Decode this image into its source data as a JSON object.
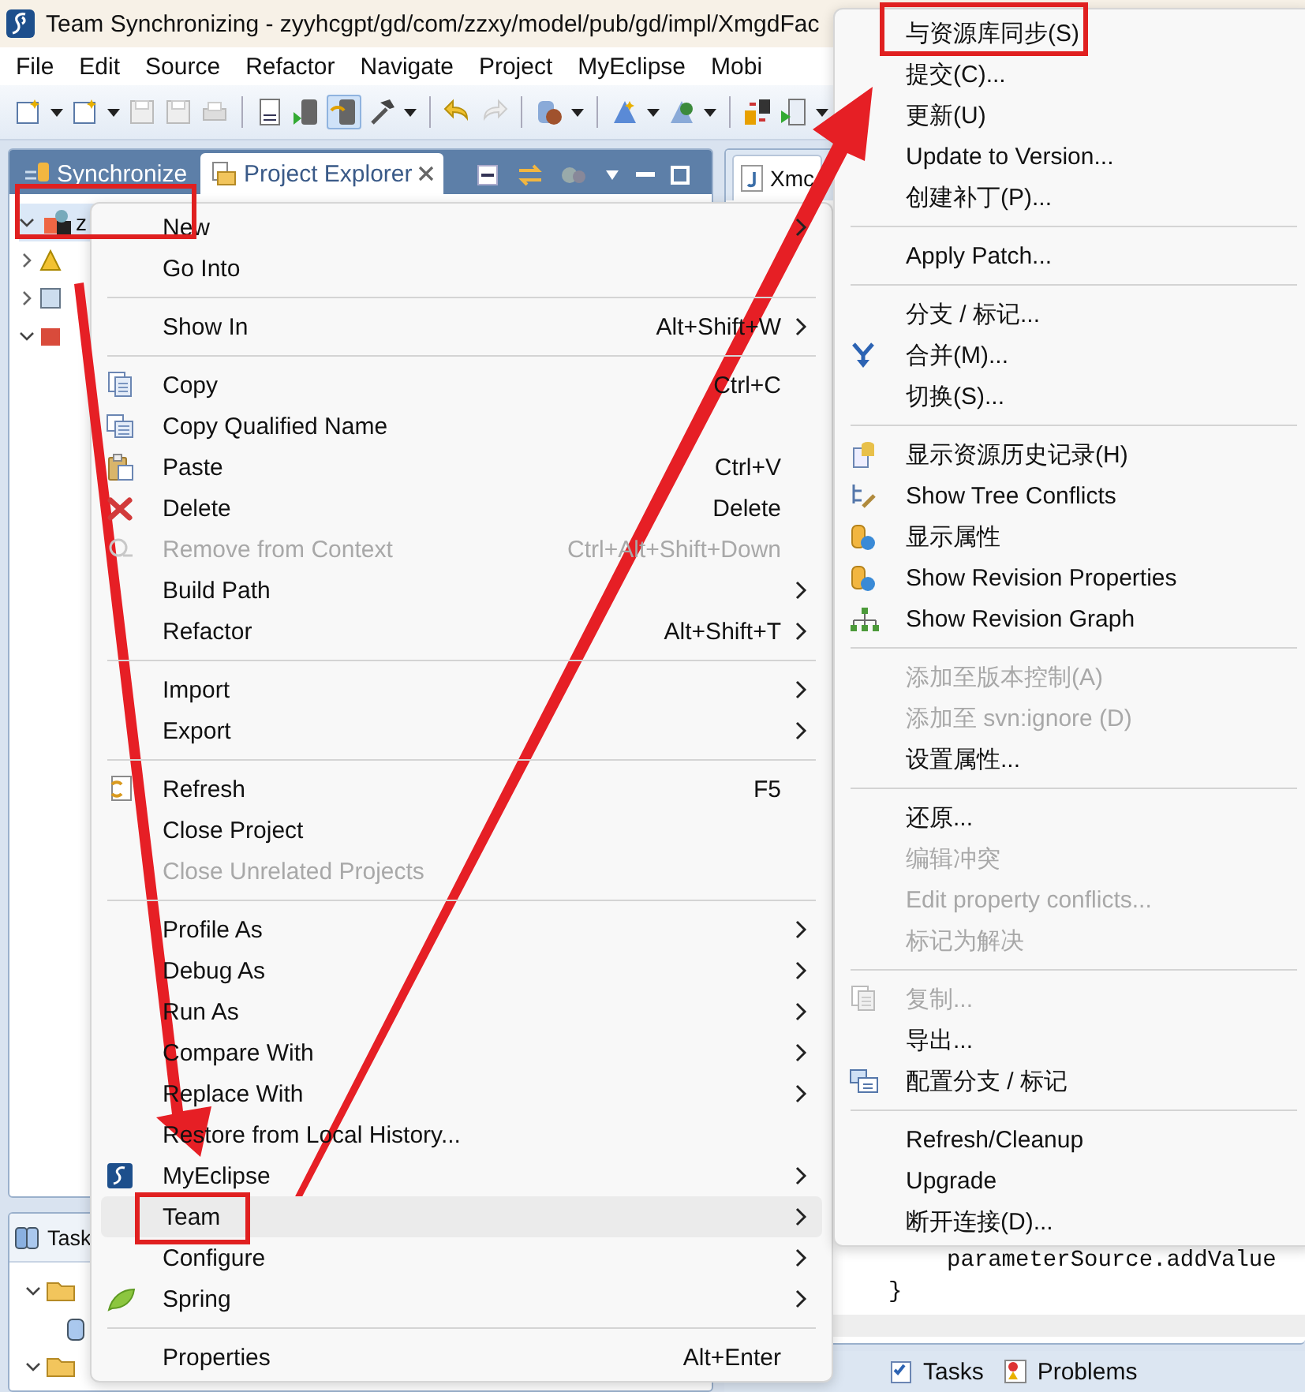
{
  "window": {
    "title": "Team Synchronizing - zyyhcgpt/gd/com/zzxy/model/pub/gd/impl/XmgdFac"
  },
  "menu_bar": [
    "File",
    "Edit",
    "Source",
    "Refactor",
    "Navigate",
    "Project",
    "MyEclipse",
    "Mobi"
  ],
  "explorer": {
    "tabs": [
      {
        "label": "Synchronize",
        "selected": false
      },
      {
        "label": "Project Explorer",
        "selected": true
      }
    ],
    "tree_root": "z"
  },
  "task_panel": {
    "tab": "Task"
  },
  "editor": {
    "tab": "Xmc",
    "code": [
      "parameterSource.addValue",
      "}"
    ],
    "bottom_tabs": [
      "Tasks",
      "Problems"
    ]
  },
  "context_menu": {
    "items": [
      {
        "kind": "item",
        "label": "New",
        "submenu": true,
        "disabled": false,
        "selected": false
      },
      {
        "kind": "item",
        "label": "Go Into",
        "submenu": false,
        "disabled": false,
        "selected": false
      },
      {
        "kind": "separator"
      },
      {
        "kind": "item",
        "label": "Show In",
        "shortcut": "Alt+Shift+W",
        "submenu": true,
        "disabled": false,
        "selected": false
      },
      {
        "kind": "separator"
      },
      {
        "kind": "item",
        "label": "Copy",
        "shortcut": "Ctrl+C",
        "submenu": false,
        "disabled": false,
        "selected": false
      },
      {
        "kind": "item",
        "label": "Copy Qualified Name",
        "submenu": false,
        "disabled": false,
        "selected": false
      },
      {
        "kind": "item",
        "label": "Paste",
        "shortcut": "Ctrl+V",
        "submenu": false,
        "disabled": false,
        "selected": false
      },
      {
        "kind": "item",
        "label": "Delete",
        "shortcut": "Delete",
        "submenu": false,
        "disabled": false,
        "selected": false
      },
      {
        "kind": "item",
        "label": "Remove from Context",
        "shortcut": "Ctrl+Alt+Shift+Down",
        "submenu": false,
        "disabled": true,
        "selected": false
      },
      {
        "kind": "item",
        "label": "Build Path",
        "submenu": true,
        "disabled": false,
        "selected": false
      },
      {
        "kind": "item",
        "label": "Refactor",
        "shortcut": "Alt+Shift+T",
        "submenu": true,
        "disabled": false,
        "selected": false
      },
      {
        "kind": "separator"
      },
      {
        "kind": "item",
        "label": "Import",
        "submenu": true,
        "disabled": false,
        "selected": false
      },
      {
        "kind": "item",
        "label": "Export",
        "submenu": true,
        "disabled": false,
        "selected": false
      },
      {
        "kind": "separator"
      },
      {
        "kind": "item",
        "label": "Refresh",
        "shortcut": "F5",
        "submenu": false,
        "disabled": false,
        "selected": false
      },
      {
        "kind": "item",
        "label": "Close Project",
        "submenu": false,
        "disabled": false,
        "selected": false
      },
      {
        "kind": "item",
        "label": "Close Unrelated Projects",
        "submenu": false,
        "disabled": true,
        "selected": false
      },
      {
        "kind": "separator"
      },
      {
        "kind": "item",
        "label": "Profile As",
        "submenu": true,
        "disabled": false,
        "selected": false
      },
      {
        "kind": "item",
        "label": "Debug As",
        "submenu": true,
        "disabled": false,
        "selected": false
      },
      {
        "kind": "item",
        "label": "Run As",
        "submenu": true,
        "disabled": false,
        "selected": false
      },
      {
        "kind": "item",
        "label": "Compare With",
        "submenu": true,
        "disabled": false,
        "selected": false
      },
      {
        "kind": "item",
        "label": "Replace With",
        "submenu": true,
        "disabled": false,
        "selected": false
      },
      {
        "kind": "item",
        "label": "Restore from Local History...",
        "submenu": false,
        "disabled": false,
        "selected": false
      },
      {
        "kind": "item",
        "label": "MyEclipse",
        "submenu": true,
        "disabled": false,
        "selected": false
      },
      {
        "kind": "item",
        "label": "Team",
        "submenu": true,
        "disabled": false,
        "selected": true
      },
      {
        "kind": "item",
        "label": "Configure",
        "submenu": true,
        "disabled": false,
        "selected": false
      },
      {
        "kind": "item",
        "label": "Spring",
        "submenu": true,
        "disabled": false,
        "selected": false
      },
      {
        "kind": "separator"
      },
      {
        "kind": "item",
        "label": "Properties",
        "shortcut": "Alt+Enter",
        "submenu": false,
        "disabled": false,
        "selected": false
      }
    ]
  },
  "team_submenu": {
    "items": [
      {
        "kind": "item",
        "label": "与资源库同步(S)",
        "disabled": false
      },
      {
        "kind": "item",
        "label": "提交(C)...",
        "disabled": false
      },
      {
        "kind": "item",
        "label": "更新(U)",
        "disabled": false
      },
      {
        "kind": "item",
        "label": "Update to Version...",
        "disabled": false
      },
      {
        "kind": "item",
        "label": "创建补丁(P)...",
        "disabled": false
      },
      {
        "kind": "separator"
      },
      {
        "kind": "item",
        "label": "Apply Patch...",
        "disabled": false
      },
      {
        "kind": "separator"
      },
      {
        "kind": "item",
        "label": "分支 / 标记...",
        "disabled": false
      },
      {
        "kind": "item",
        "label": "合并(M)...",
        "disabled": false
      },
      {
        "kind": "item",
        "label": "切换(S)...",
        "disabled": false
      },
      {
        "kind": "separator"
      },
      {
        "kind": "item",
        "label": "显示资源历史记录(H)",
        "disabled": false
      },
      {
        "kind": "item",
        "label": "Show Tree Conflicts",
        "disabled": false
      },
      {
        "kind": "item",
        "label": "显示属性",
        "disabled": false
      },
      {
        "kind": "item",
        "label": "Show Revision Properties",
        "disabled": false
      },
      {
        "kind": "item",
        "label": "Show Revision Graph",
        "disabled": false
      },
      {
        "kind": "separator"
      },
      {
        "kind": "item",
        "label": "添加至版本控制(A)",
        "disabled": true
      },
      {
        "kind": "item",
        "label": "添加至 svn:ignore (D)",
        "disabled": true
      },
      {
        "kind": "item",
        "label": "设置属性...",
        "disabled": false
      },
      {
        "kind": "separator"
      },
      {
        "kind": "item",
        "label": "还原...",
        "disabled": false
      },
      {
        "kind": "item",
        "label": "编辑冲突",
        "disabled": true
      },
      {
        "kind": "item",
        "label": "Edit property conflicts...",
        "disabled": true
      },
      {
        "kind": "item",
        "label": "标记为解决",
        "disabled": true
      },
      {
        "kind": "separator"
      },
      {
        "kind": "item",
        "label": "复制...",
        "disabled": true
      },
      {
        "kind": "item",
        "label": "导出...",
        "disabled": false
      },
      {
        "kind": "item",
        "label": "配置分支 / 标记",
        "disabled": false
      },
      {
        "kind": "separator"
      },
      {
        "kind": "item",
        "label": "Refresh/Cleanup",
        "disabled": false
      },
      {
        "kind": "item",
        "label": "Upgrade",
        "disabled": false
      },
      {
        "kind": "item",
        "label": "断开连接(D)...",
        "disabled": false
      }
    ]
  }
}
